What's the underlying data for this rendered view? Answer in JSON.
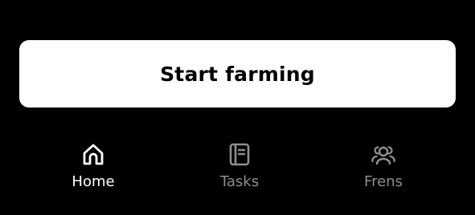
{
  "main": {
    "start_button_label": "Start farming"
  },
  "nav": {
    "items": [
      {
        "label": "Home",
        "icon": "home-icon",
        "active": true
      },
      {
        "label": "Tasks",
        "icon": "tasks-icon",
        "active": false
      },
      {
        "label": "Frens",
        "icon": "frens-icon",
        "active": false
      }
    ]
  },
  "colors": {
    "background": "#000000",
    "button": "#ffffff",
    "active": "#ffffff",
    "inactive": "#8e8e8e"
  }
}
